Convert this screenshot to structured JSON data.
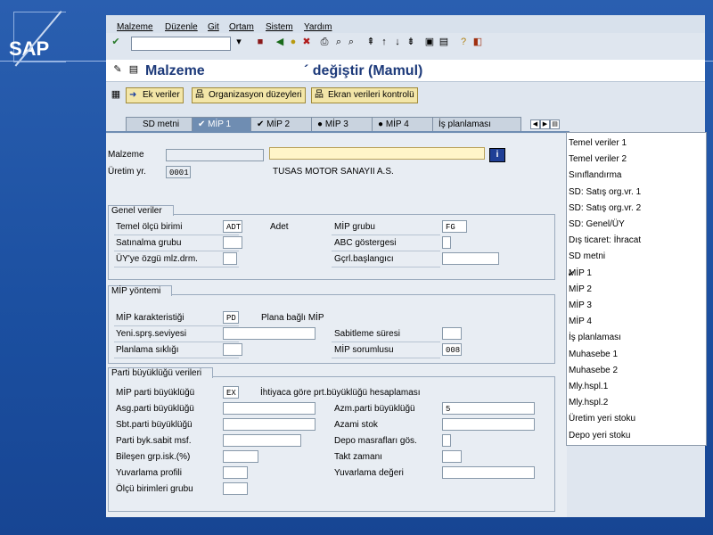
{
  "logo": {
    "text": "SAP"
  },
  "menu": [
    "Malzeme",
    "Düzenle",
    "Git",
    "Ortam",
    "Sistem",
    "Yardım"
  ],
  "title": {
    "prefix": "Malzeme",
    "suffix": "´ değiştir (Mamul)"
  },
  "app_buttons": [
    "Ek veriler",
    "Organizasyon düzeyleri",
    "Ekran verileri kontrolü"
  ],
  "tabs": [
    "SD metni",
    "MİP 1",
    "MİP 2",
    "MİP 3",
    "MİP 4",
    "İş planlaması"
  ],
  "active_tab": "MİP 1",
  "header": {
    "malzeme_label": "Malzeme",
    "uretim_label": "Üretim yr.",
    "uretim_value": "0001",
    "plant_name": "TUSAS MOTOR SANAYII A.S."
  },
  "genel": {
    "title": "Genel veriler",
    "temel_label": "Temel ölçü birimi",
    "temel_value": "ADT",
    "temel_text": "Adet",
    "satin_label": "Satınalma grubu",
    "uy_label": "ÜY'ye özgü mlz.drm.",
    "mip_grubu_label": "MİP grubu",
    "mip_grubu_value": "FG",
    "abc_label": "ABC göstergesi",
    "gcrl_label": "Gçrl.başlangıcı"
  },
  "yontem": {
    "title": "MİP yöntemi",
    "kar_label": "MİP karakteristiği",
    "kar_value": "PD",
    "kar_text": "Plana bağlı MİP",
    "yeni_label": "Yeni.sprş.seviyesi",
    "plan_label": "Planlama sıklığı",
    "sabit_label": "Sabitleme süresi",
    "sorum_label": "MİP sorumlusu",
    "sorum_value": "008"
  },
  "parti": {
    "title": "Parti büyüklüğü verileri",
    "mip_label": "MİP parti büyüklüğü",
    "mip_value": "EX",
    "mip_text": "İhtiyaca göre prt.büyüklüğü hesaplaması",
    "asg_label": "Asg.parti büyüklüğü",
    "sbt_label": "Sbt.parti büyüklüğü",
    "byk_label": "Parti byk.sabit msf.",
    "bil_label": "Bileşen grp.isk.(%)",
    "yuv_label": "Yuvarlama profili",
    "olcu_label": "Ölçü birimleri grubu",
    "azm_label": "Azm.parti büyüklüğü",
    "azm_value": "5",
    "azami_label": "Azami stok",
    "depo_label": "Depo masrafları gös.",
    "takt_label": "Takt zamanı",
    "yuvd_label": "Yuvarlama değeri"
  },
  "dropdown": [
    "Temel veriler 1",
    "Temel veriler 2",
    "Sınıflandırma",
    "SD: Satış org.vr. 1",
    "SD: Satış org.vr. 2",
    "SD: Genel/ÜY",
    "Dış ticaret: İhracat",
    "SD metni",
    "MİP 1",
    "MİP 2",
    "MİP 3",
    "MİP 4",
    "İş planlaması",
    "Muhasebe 1",
    "Muhasebe 2",
    "Mly.hspl.1",
    "Mly.hspl.2",
    "Üretim yeri stoku",
    "Depo yeri stoku"
  ],
  "dropdown_checked": "MİP 1",
  "info_icon": "i"
}
